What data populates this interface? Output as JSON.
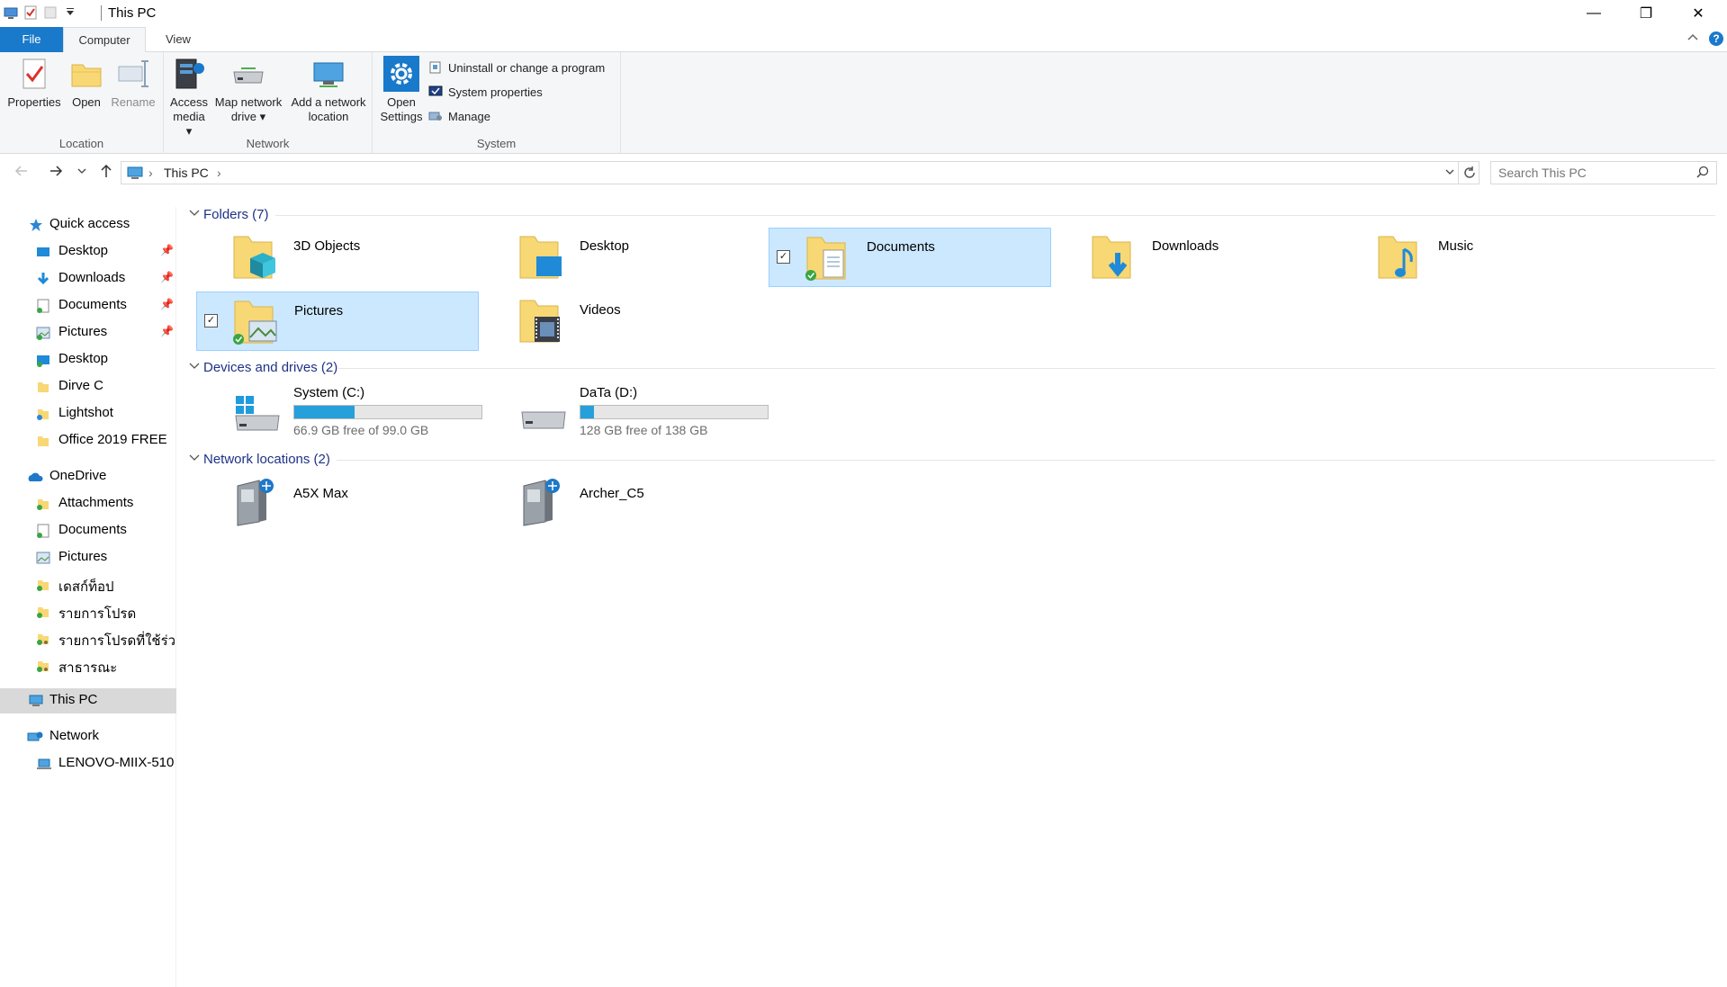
{
  "window": {
    "title": "This PC",
    "minimize": "—",
    "maximize": "❐",
    "close": "✕"
  },
  "tabs": {
    "file": "File",
    "computer": "Computer",
    "view": "View"
  },
  "ribbon": {
    "location": {
      "label": "Location",
      "properties": "Properties",
      "open": "Open",
      "rename": "Rename"
    },
    "network": {
      "label": "Network",
      "access_media_1": "Access",
      "access_media_2": "media",
      "map_drive_1": "Map network",
      "map_drive_2": "drive",
      "add_location_1": "Add a network",
      "add_location_2": "location"
    },
    "system": {
      "label": "System",
      "open_settings_1": "Open",
      "open_settings_2": "Settings",
      "uninstall": "Uninstall or change a program",
      "system_properties": "System properties",
      "manage": "Manage"
    }
  },
  "address": {
    "path": "This PC",
    "search_placeholder": "Search This PC"
  },
  "sidebar": {
    "quick_access": "Quick access",
    "quick_items": [
      "Desktop",
      "Downloads",
      "Documents",
      "Pictures",
      "Desktop",
      "Dirve C",
      "Lightshot",
      "Office 2019 FREE"
    ],
    "onedrive": "OneDrive",
    "onedrive_items": [
      "Attachments",
      "Documents",
      "Pictures",
      "เดสก์ท็อป",
      "รายการโปรด",
      "รายการโปรดที่ใช้ร่วมกั",
      "สาธารณะ"
    ],
    "this_pc": "This PC",
    "network": "Network",
    "network_items": [
      "LENOVO-MIIX-510"
    ]
  },
  "content": {
    "folders_header": "Folders (7)",
    "folders": [
      "3D Objects",
      "Desktop",
      "Documents",
      "Downloads",
      "Music",
      "Pictures",
      "Videos"
    ],
    "drives_header": "Devices and drives (2)",
    "drives": [
      {
        "name": "System (C:)",
        "free": "66.9 GB free of 99.0 GB",
        "used_fraction": 0.324
      },
      {
        "name": "DaTa (D:)",
        "free": "128 GB free of 138 GB",
        "used_fraction": 0.072
      }
    ],
    "network_header": "Network locations (2)",
    "network_locations": [
      "A5X Max",
      "Archer_C5"
    ]
  },
  "colors": {
    "accent": "#1979ca",
    "selection": "#cce8ff",
    "drive_bar": "#26a0da",
    "folder": "#f8d775"
  }
}
